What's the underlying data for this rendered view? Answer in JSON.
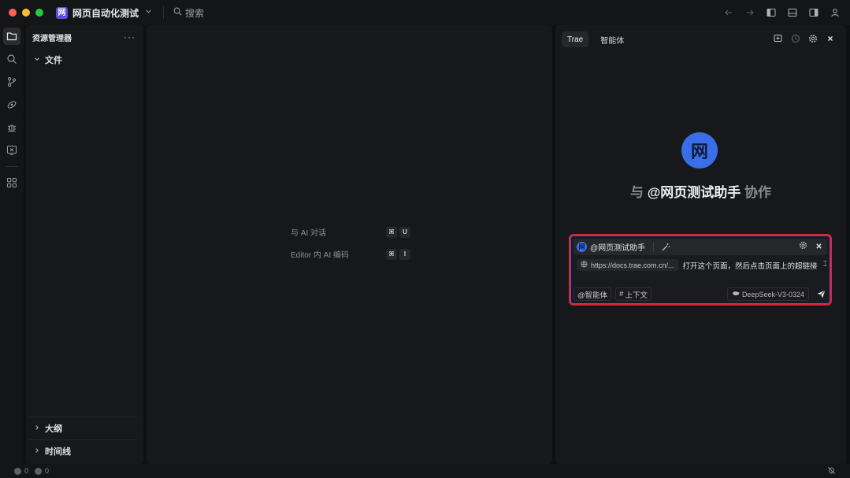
{
  "titlebar": {
    "project_logo": "网",
    "project_name": "网页自动化测试",
    "search_placeholder": "搜索"
  },
  "explorer": {
    "title": "资源管理器",
    "more": "···",
    "root_folder": "文件",
    "outline": "大纲",
    "timeline": "时间线"
  },
  "editor": {
    "hint_chat": "与 AI 对话",
    "hint_chat_keys": [
      "⌘",
      "U"
    ],
    "hint_inline": "Editor 内 AI 编码",
    "hint_inline_keys": [
      "⌘",
      "I"
    ]
  },
  "ai_panel": {
    "tabs": [
      {
        "label": "Trae",
        "active": true
      },
      {
        "label": "智能体",
        "active": false
      }
    ],
    "agent_logo": "网",
    "collab_prefix": "与",
    "collab_name": "@网页测试助手",
    "collab_suffix": "协作",
    "chat": {
      "agent_label": "@网页测试助手",
      "url_chip": "https://docs.trae.com.cn/...",
      "message": "打开这个页面，然后点击页面上的超链接",
      "mention_chip": "@智能体",
      "context_chip": "上下文",
      "context_hash": "#",
      "model": "DeepSeek-V3-0324"
    }
  },
  "statusbar": {
    "errors": "0",
    "warnings": "0"
  },
  "colors": {
    "accent_blue": "#3a6ee8",
    "chat_border": "#d4273a",
    "project_logo_bg": "#5b4de0"
  }
}
